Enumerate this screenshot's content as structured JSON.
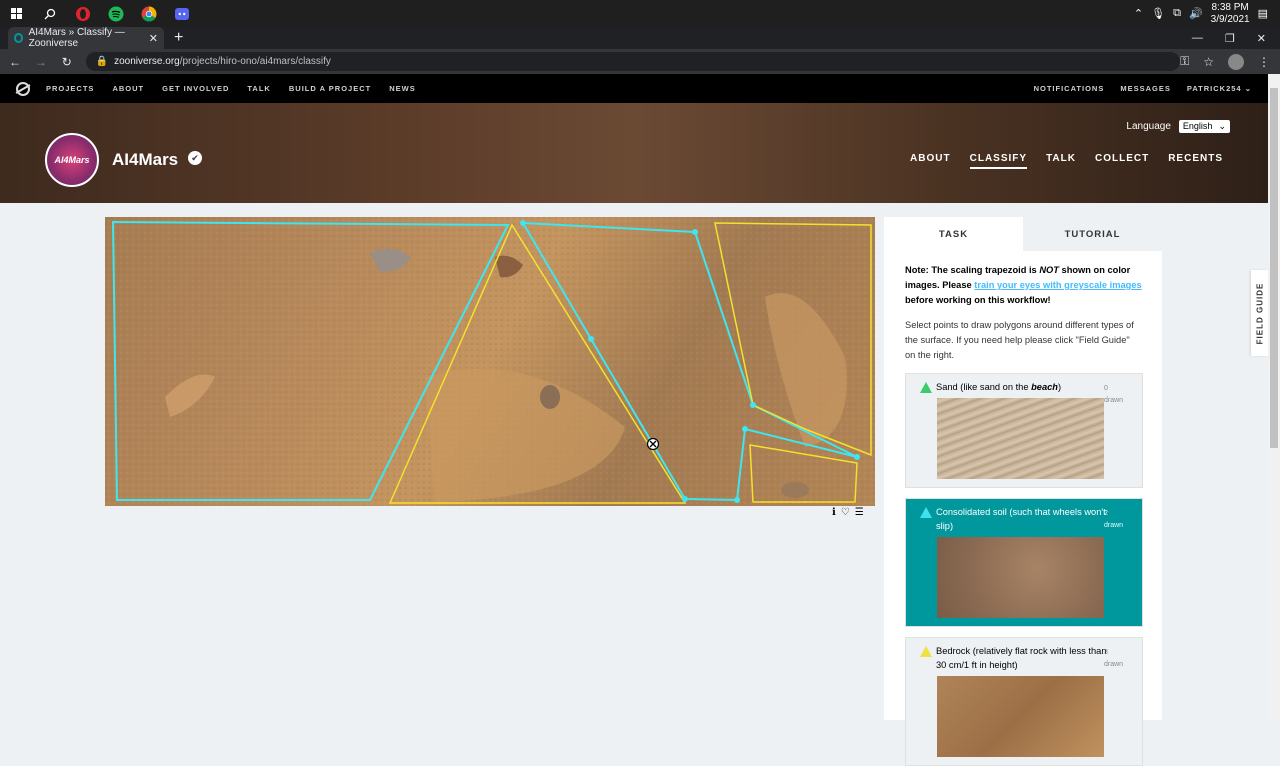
{
  "taskbar": {
    "time": "8:38 PM",
    "date": "3/9/2021"
  },
  "browser": {
    "tab_title": "AI4Mars » Classify — Zooniverse",
    "url_host": "zooniverse.org",
    "url_path": "/projects/hiro-ono/ai4mars/classify"
  },
  "zoo_nav": {
    "left": [
      "PROJECTS",
      "ABOUT",
      "GET INVOLVED",
      "TALK",
      "BUILD A PROJECT",
      "NEWS"
    ],
    "right": [
      "NOTIFICATIONS",
      "MESSAGES",
      "PATRICK254"
    ]
  },
  "project": {
    "title": "AI4Mars",
    "avatar_text": "AI4Mars",
    "language_label": "Language",
    "language_value": "English",
    "nav": [
      "ABOUT",
      "CLASSIFY",
      "TALK",
      "COLLECT",
      "RECENTS"
    ],
    "active_nav": "CLASSIFY"
  },
  "task_panel": {
    "tabs": [
      "TASK",
      "TUTORIAL"
    ],
    "note_prefix": "Note: The scaling trapezoid is ",
    "note_em": "NOT",
    "note_mid": " shown on color images. Please ",
    "note_link": "train your eyes with greyscale images",
    "note_suffix": " before working on this workflow!",
    "instruction": "Select points to draw polygons around different types of the surface. If you need help please click \"Field Guide\" on the right.",
    "tools": [
      {
        "label_pre": "Sand (like sand on the ",
        "label_em": "beach",
        "label_post": ")",
        "count": "0",
        "drawn": "drawn",
        "color": "#3dcc6a"
      },
      {
        "label_pre": "Consolidated soil (such that wheels won't slip)",
        "label_em": "",
        "label_post": "",
        "count": "2",
        "drawn": "drawn",
        "color": "#40e0f0"
      },
      {
        "label_pre": "Bedrock (relatively flat rock with less than 30 cm/1 ft in height)",
        "label_em": "",
        "label_post": "",
        "count": "3",
        "drawn": "drawn",
        "color": "#f0e040"
      }
    ]
  },
  "field_guide_label": "FIELD GUIDE",
  "colors": {
    "teal": "#00979d",
    "cyan_polygon": "#3de6f0",
    "yellow_polygon": "#f2e22c",
    "link": "#43bbfd"
  }
}
